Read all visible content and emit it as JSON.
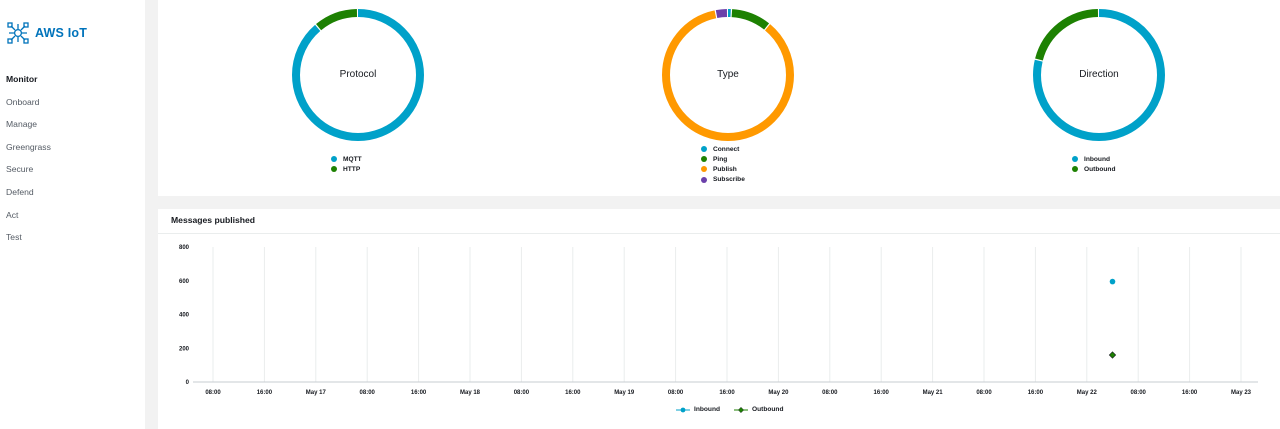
{
  "app": {
    "title": "AWS IoT",
    "logo_icon": "aws-iot-icon",
    "brand_color": "#0073bb"
  },
  "sidebar": {
    "items": [
      {
        "label": "Monitor",
        "active": true
      },
      {
        "label": "Onboard"
      },
      {
        "label": "Manage"
      },
      {
        "label": "Greengrass"
      },
      {
        "label": "Secure"
      },
      {
        "label": "Defend"
      },
      {
        "label": "Act"
      },
      {
        "label": "Test"
      }
    ]
  },
  "donuts": [
    {
      "center_label": "Protocol",
      "segments": [
        {
          "name": "MQTT",
          "fraction": 0.89,
          "color": "#00a1c9"
        },
        {
          "name": "HTTP",
          "fraction": 0.11,
          "color": "#1d8102"
        }
      ]
    },
    {
      "center_label": "Type",
      "segments": [
        {
          "name": "Connect",
          "fraction": 0.01,
          "color": "#00a1c9"
        },
        {
          "name": "Ping",
          "fraction": 0.1,
          "color": "#1d8102"
        },
        {
          "name": "Publish",
          "fraction": 0.86,
          "color": "#ff9900"
        },
        {
          "name": "Subscribe",
          "fraction": 0.03,
          "color": "#6b40aa"
        }
      ]
    },
    {
      "center_label": "Direction",
      "segments": [
        {
          "name": "Inbound",
          "fraction": 0.79,
          "color": "#00a1c9"
        },
        {
          "name": "Outbound",
          "fraction": 0.21,
          "color": "#1d8102"
        }
      ]
    }
  ],
  "messages_panel": {
    "title": "Messages published"
  },
  "chart_data": {
    "type": "scatter",
    "title": "Messages published",
    "xlabel": "",
    "ylabel": "",
    "ylim": [
      0,
      800
    ],
    "yticks": [
      "0",
      "200",
      "400",
      "600",
      "800"
    ],
    "xticks": [
      "08:00",
      "16:00",
      "May 17",
      "08:00",
      "16:00",
      "May 18",
      "08:00",
      "16:00",
      "May 19",
      "08:00",
      "16:00",
      "May 20",
      "08:00",
      "16:00",
      "May 21",
      "08:00",
      "16:00",
      "May 22",
      "08:00",
      "16:00",
      "May 23"
    ],
    "grid": true,
    "legend_position": "bottom",
    "series": [
      {
        "name": "Inbound",
        "color": "#00a1c9",
        "marker": "circle",
        "points": [
          {
            "x": "May 22 ~04:00",
            "y": 595
          }
        ]
      },
      {
        "name": "Outbound",
        "color": "#1d8102",
        "marker": "diamond",
        "points": [
          {
            "x": "May 22 ~04:00",
            "y": 160
          }
        ]
      }
    ]
  }
}
